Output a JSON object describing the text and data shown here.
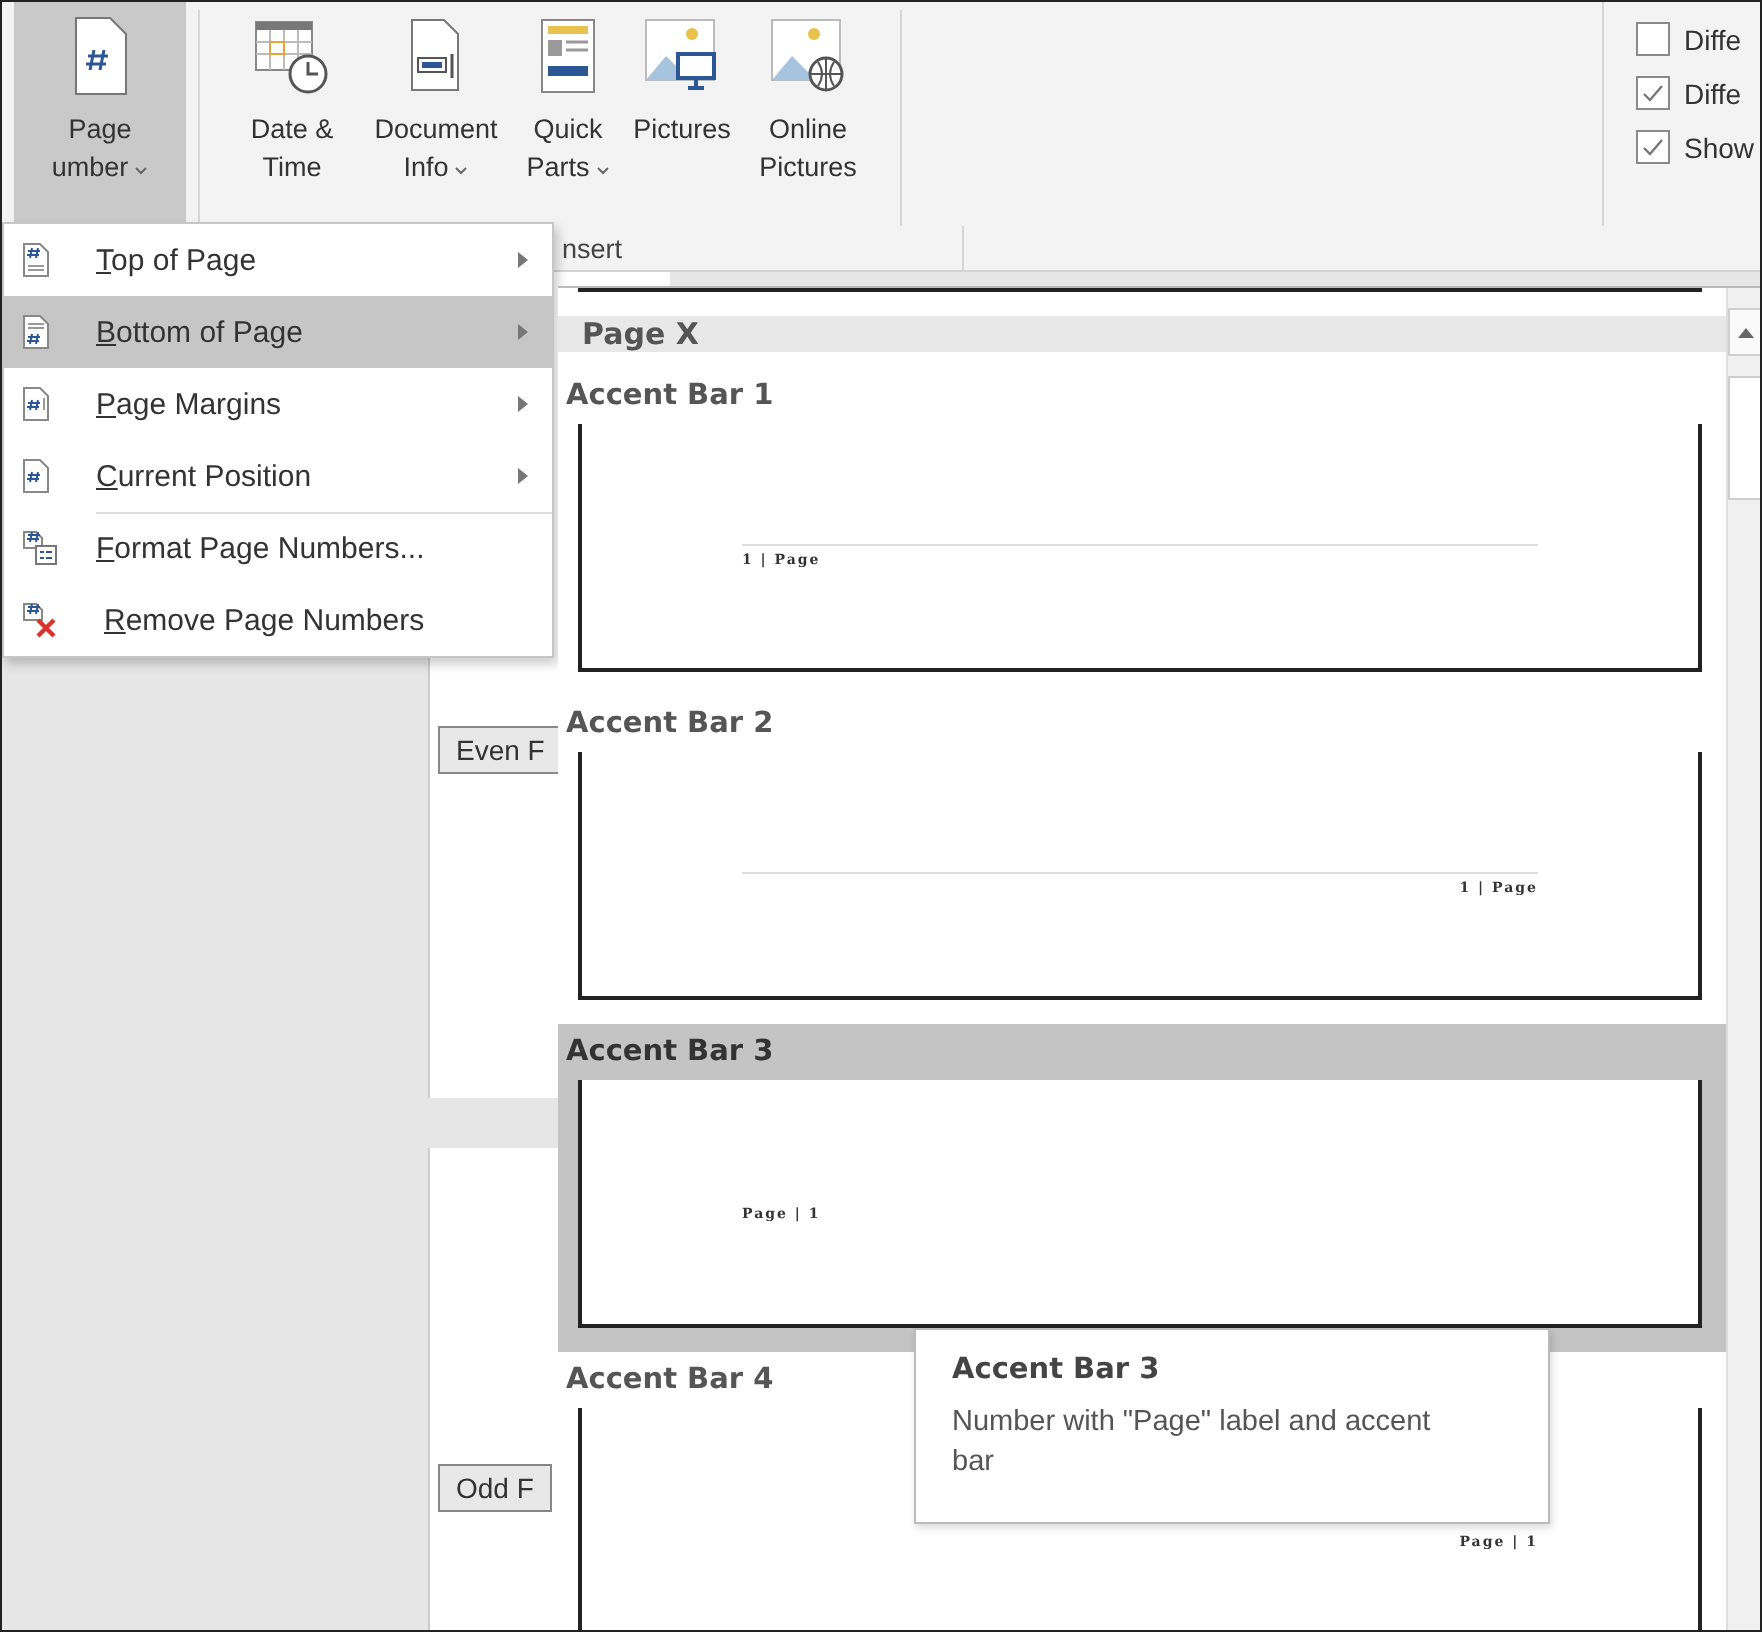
{
  "ribbon": {
    "buttons": [
      {
        "kind": "page-number",
        "lines": [
          "Page",
          "umber"
        ],
        "dropdown": true,
        "selected": true
      },
      {
        "kind": "date-time",
        "lines": [
          "Date &",
          "Time"
        ],
        "dropdown": false,
        "selected": false
      },
      {
        "kind": "document-info",
        "lines": [
          "Document",
          "Info"
        ],
        "dropdown": true,
        "selected": false
      },
      {
        "kind": "quick-parts",
        "lines": [
          "Quick",
          "Parts"
        ],
        "dropdown": true,
        "selected": false
      },
      {
        "kind": "pictures",
        "lines": [
          "Pictures"
        ],
        "dropdown": false,
        "selected": false
      },
      {
        "kind": "online-pictures",
        "lines": [
          "Online",
          "Pictures"
        ],
        "dropdown": false,
        "selected": false
      }
    ],
    "group_label": "nsert",
    "options": [
      {
        "label": "Diffe",
        "checked": false
      },
      {
        "label": "Diffe",
        "checked": true
      },
      {
        "label": "Show",
        "checked": true
      }
    ]
  },
  "document": {
    "labels": [
      "Even F",
      "Odd F"
    ]
  },
  "menu": {
    "items": [
      {
        "kind": "top",
        "label": "Top of Page",
        "submenu": true,
        "selected": false,
        "divider_before": false
      },
      {
        "kind": "bottom",
        "label": "Bottom of Page",
        "submenu": true,
        "selected": true,
        "divider_before": false
      },
      {
        "kind": "margins",
        "label": "Page Margins",
        "submenu": true,
        "selected": false,
        "divider_before": false
      },
      {
        "kind": "current",
        "label": "Current Position",
        "submenu": true,
        "selected": false,
        "divider_before": false
      },
      {
        "kind": "format",
        "label": "Format Page Numbers...",
        "submenu": false,
        "selected": false,
        "divider_before": true
      },
      {
        "kind": "remove",
        "label": "Remove Page Numbers",
        "submenu": false,
        "selected": false,
        "divider_before": false
      }
    ]
  },
  "gallery": {
    "section": "Page X",
    "items": [
      {
        "title": "Accent Bar 1",
        "preview": "1 | Page",
        "kind": "rule-left",
        "selected": false
      },
      {
        "title": "Accent Bar 2",
        "preview": "1 | Page",
        "kind": "rule-right",
        "selected": false
      },
      {
        "title": "Accent Bar 3",
        "preview": "Page | 1",
        "kind": "plain-left",
        "selected": true
      },
      {
        "title": "Accent Bar 4",
        "preview": "Page | 1",
        "kind": "plain-right",
        "selected": false
      }
    ]
  },
  "tooltip": {
    "title": "Accent Bar 3",
    "description": "Number with \"Page\" label and accent bar"
  }
}
